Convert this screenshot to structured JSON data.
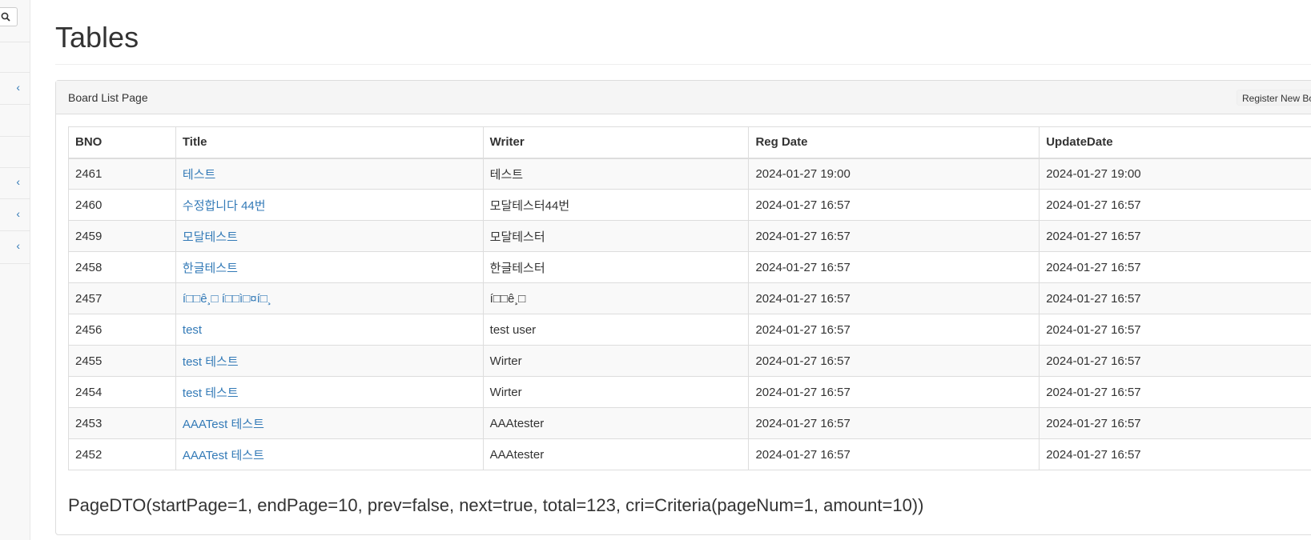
{
  "page": {
    "title": "Tables"
  },
  "panel": {
    "heading": "Board List Page",
    "register_button": "Register New Bo"
  },
  "table": {
    "headers": [
      "BNO",
      "Title",
      "Writer",
      "Reg Date",
      "UpdateDate"
    ],
    "rows": [
      {
        "bno": "2461",
        "title": "테스트",
        "writer": "테스트",
        "regdate": "2024-01-27 19:00",
        "updatedate": "2024-01-27 19:00"
      },
      {
        "bno": "2460",
        "title": "수정합니다 44번",
        "writer": "모달테스터44번",
        "regdate": "2024-01-27 16:57",
        "updatedate": "2024-01-27 16:57"
      },
      {
        "bno": "2459",
        "title": "모달테스트",
        "writer": "모달테스터",
        "regdate": "2024-01-27 16:57",
        "updatedate": "2024-01-27 16:57"
      },
      {
        "bno": "2458",
        "title": "한글테스트",
        "writer": "한글테스터",
        "regdate": "2024-01-27 16:57",
        "updatedate": "2024-01-27 16:57"
      },
      {
        "bno": "2457",
        "title": "í□□ê¸□ í□□ì□¤í□¸",
        "writer": "í□□ê¸□",
        "regdate": "2024-01-27 16:57",
        "updatedate": "2024-01-27 16:57"
      },
      {
        "bno": "2456",
        "title": "test",
        "writer": "test user",
        "regdate": "2024-01-27 16:57",
        "updatedate": "2024-01-27 16:57"
      },
      {
        "bno": "2455",
        "title": "test 테스트",
        "writer": "Wirter",
        "regdate": "2024-01-27 16:57",
        "updatedate": "2024-01-27 16:57"
      },
      {
        "bno": "2454",
        "title": "test 테스트",
        "writer": "Wirter",
        "regdate": "2024-01-27 16:57",
        "updatedate": "2024-01-27 16:57"
      },
      {
        "bno": "2453",
        "title": "AAATest 테스트",
        "writer": "AAAtester",
        "regdate": "2024-01-27 16:57",
        "updatedate": "2024-01-27 16:57"
      },
      {
        "bno": "2452",
        "title": "AAATest 테스트",
        "writer": "AAAtester",
        "regdate": "2024-01-27 16:57",
        "updatedate": "2024-01-27 16:57"
      }
    ]
  },
  "page_dto": "PageDTO(startPage=1, endPage=10, prev=false, next=true, total=123, cri=Criteria(pageNum=1, amount=10))",
  "sidebar": {
    "icons": [
      "search-icon",
      "chevron-left-icon"
    ]
  },
  "colors": {
    "link": "#337ab7",
    "panel_heading_bg": "#f5f5f5",
    "stripe_bg": "#f9f9f9",
    "border": "#dddddd"
  }
}
